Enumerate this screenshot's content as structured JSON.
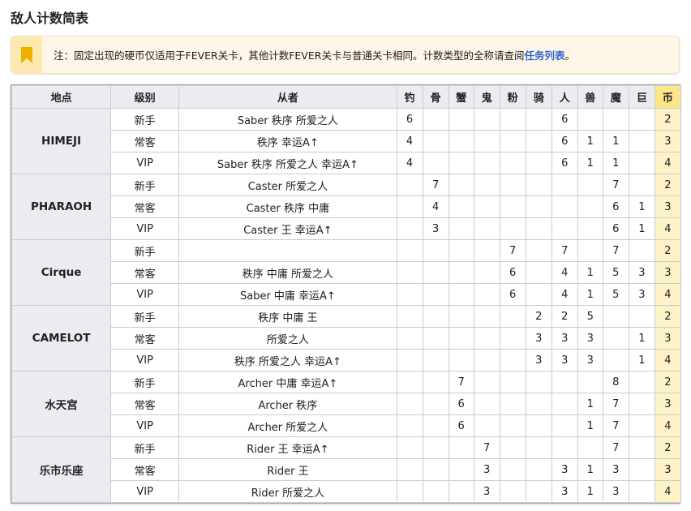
{
  "title": "敌人计数简表",
  "note": {
    "text": "注：固定出现的硬币仅适用于FEVER关卡，其他计数FEVER关卡与普通关卡相同。计数类型的全称请查阅",
    "link": "任务列表",
    "end": "。",
    "icon": "bookmark-icon"
  },
  "headers": [
    "地点",
    "级别",
    "从者",
    "钓",
    "骨",
    "蟹",
    "鬼",
    "粉",
    "骑",
    "人",
    "兽",
    "魔",
    "巨",
    "币"
  ],
  "groups": [
    {
      "place": "HIMEJI",
      "rows": [
        {
          "level": "新手",
          "servant": "Saber 秩序 所爱之人",
          "c": [
            "6",
            "",
            "",
            "",
            "",
            "",
            "6",
            "",
            "",
            "",
            "2"
          ]
        },
        {
          "level": "常客",
          "servant": "秩序 幸运A↑",
          "c": [
            "4",
            "",
            "",
            "",
            "",
            "",
            "6",
            "1",
            "1",
            "",
            "3"
          ]
        },
        {
          "level": "VIP",
          "servant": "Saber 秩序 所爱之人 幸运A↑",
          "c": [
            "4",
            "",
            "",
            "",
            "",
            "",
            "6",
            "1",
            "1",
            "",
            "4"
          ]
        }
      ]
    },
    {
      "place": "PHARAOH",
      "rows": [
        {
          "level": "新手",
          "servant": "Caster 所爱之人",
          "c": [
            "",
            "7",
            "",
            "",
            "",
            "",
            "",
            "",
            "7",
            "",
            "2"
          ]
        },
        {
          "level": "常客",
          "servant": "Caster 秩序 中庸",
          "c": [
            "",
            "4",
            "",
            "",
            "",
            "",
            "",
            "",
            "6",
            "1",
            "3"
          ]
        },
        {
          "level": "VIP",
          "servant": "Caster 王 幸运A↑",
          "c": [
            "",
            "3",
            "",
            "",
            "",
            "",
            "",
            "",
            "6",
            "1",
            "4"
          ]
        }
      ]
    },
    {
      "place": "Cirque",
      "rows": [
        {
          "level": "新手",
          "servant": "",
          "c": [
            "",
            "",
            "",
            "",
            "7",
            "",
            "7",
            "",
            "7",
            "",
            "2"
          ]
        },
        {
          "level": "常客",
          "servant": "秩序 中庸 所爱之人",
          "c": [
            "",
            "",
            "",
            "",
            "6",
            "",
            "4",
            "1",
            "5",
            "3",
            "3"
          ]
        },
        {
          "level": "VIP",
          "servant": "Saber 中庸 幸运A↑",
          "c": [
            "",
            "",
            "",
            "",
            "6",
            "",
            "4",
            "1",
            "5",
            "3",
            "4"
          ]
        }
      ]
    },
    {
      "place": "CAMELOT",
      "rows": [
        {
          "level": "新手",
          "servant": "秩序 中庸 王",
          "c": [
            "",
            "",
            "",
            "",
            "",
            "2",
            "2",
            "5",
            "",
            "",
            "2"
          ]
        },
        {
          "level": "常客",
          "servant": "所爱之人",
          "c": [
            "",
            "",
            "",
            "",
            "",
            "3",
            "3",
            "3",
            "",
            "1",
            "3"
          ]
        },
        {
          "level": "VIP",
          "servant": "秩序 所爱之人 幸运A↑",
          "c": [
            "",
            "",
            "",
            "",
            "",
            "3",
            "3",
            "3",
            "",
            "1",
            "4"
          ]
        }
      ]
    },
    {
      "place": "水天宫",
      "rows": [
        {
          "level": "新手",
          "servant": "Archer 中庸 幸运A↑",
          "c": [
            "",
            "",
            "7",
            "",
            "",
            "",
            "",
            "",
            "8",
            "",
            "2"
          ]
        },
        {
          "level": "常客",
          "servant": "Archer 秩序",
          "c": [
            "",
            "",
            "6",
            "",
            "",
            "",
            "",
            "1",
            "7",
            "",
            "3"
          ]
        },
        {
          "level": "VIP",
          "servant": "Archer 所爱之人",
          "c": [
            "",
            "",
            "6",
            "",
            "",
            "",
            "",
            "1",
            "7",
            "",
            "4"
          ]
        }
      ]
    },
    {
      "place": "乐市乐座",
      "rows": [
        {
          "level": "新手",
          "servant": "Rider 王 幸运A↑",
          "c": [
            "",
            "",
            "",
            "7",
            "",
            "",
            "",
            "",
            "7",
            "",
            "2"
          ]
        },
        {
          "level": "常客",
          "servant": "Rider 王",
          "c": [
            "",
            "",
            "",
            "3",
            "",
            "",
            "3",
            "1",
            "3",
            "",
            "3"
          ]
        },
        {
          "level": "VIP",
          "servant": "Rider 所爱之人",
          "c": [
            "",
            "",
            "",
            "3",
            "",
            "",
            "3",
            "1",
            "3",
            "",
            "4"
          ]
        }
      ]
    }
  ]
}
